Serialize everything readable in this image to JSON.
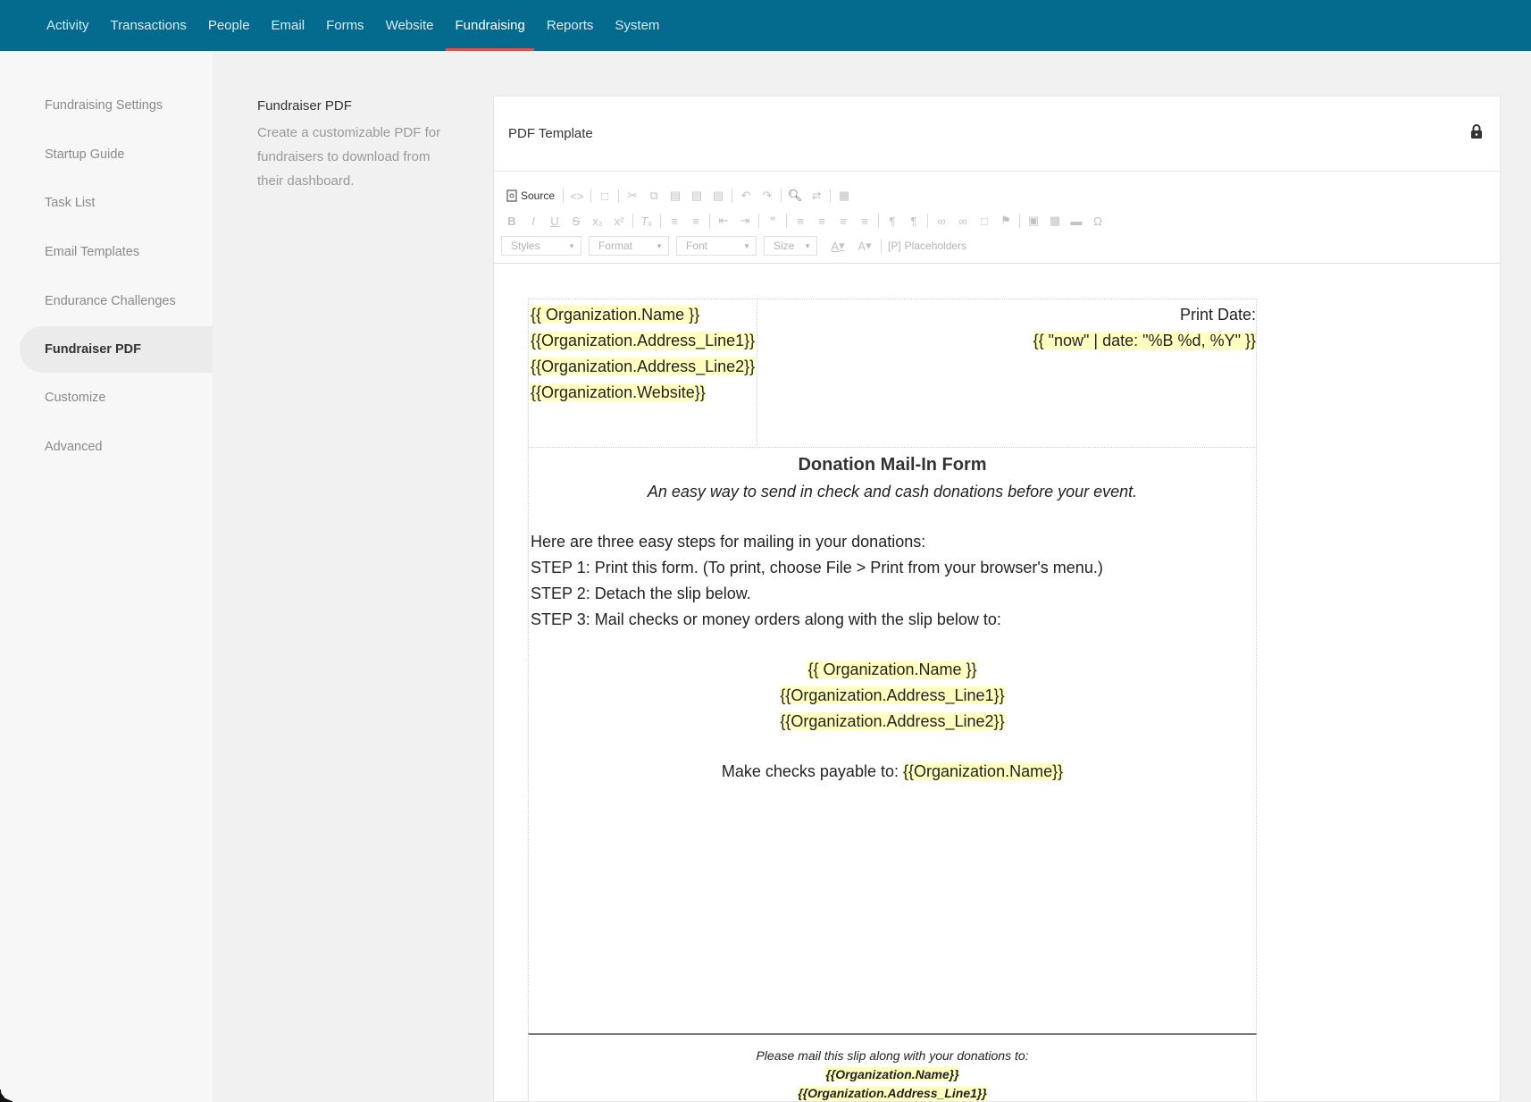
{
  "topnav": {
    "items": [
      {
        "label": "Activity",
        "active": false
      },
      {
        "label": "Transactions",
        "active": false
      },
      {
        "label": "People",
        "active": false
      },
      {
        "label": "Email",
        "active": false
      },
      {
        "label": "Forms",
        "active": false
      },
      {
        "label": "Website",
        "active": false
      },
      {
        "label": "Fundraising",
        "active": true
      },
      {
        "label": "Reports",
        "active": false
      },
      {
        "label": "System",
        "active": false
      }
    ],
    "active_underline_color": "#d9544f",
    "bg_color": "#046b8e"
  },
  "sidebar": {
    "items": [
      {
        "label": "Fundraising Settings",
        "active": false
      },
      {
        "label": "Startup Guide",
        "active": false
      },
      {
        "label": "Task List",
        "active": false
      },
      {
        "label": "Email Templates",
        "active": false
      },
      {
        "label": "Endurance Challenges",
        "active": false
      },
      {
        "label": "Fundraiser PDF",
        "active": true
      },
      {
        "label": "Customize",
        "active": false
      },
      {
        "label": "Advanced",
        "active": false
      }
    ]
  },
  "description": {
    "title": "Fundraiser PDF",
    "text": "Create a customizable PDF for fundraisers to download from their dashboard."
  },
  "panel": {
    "title": "PDF Template",
    "lock_icon": "lock-icon"
  },
  "toolbar": {
    "source_label": "Source",
    "styles_label": "Styles",
    "format_label": "Format",
    "font_label": "Font",
    "size_label": "Size",
    "text_color_label": "A",
    "bg_color_label": "A",
    "placeholders_label": "Placeholders",
    "placeholders_icon_text": "[P]"
  },
  "document": {
    "header_left": [
      "{{ Organization.Name }}",
      "{{Organization.Address_Line1}}",
      "{{Organization.Address_Line2}}",
      "{{Organization.Website}}"
    ],
    "print_date_label": "Print Date:",
    "print_date_value": "{{ \"now\" | date: \"%B %d, %Y\" }}",
    "form_title": "Donation Mail-In Form",
    "form_subtitle": "An easy way to send in check and cash donations before your event.",
    "intro": "Here are three easy steps for mailing in your donations:",
    "steps": [
      "STEP 1: Print this form. (To print, choose File > Print from your browser's menu.)",
      "STEP 2: Detach the slip below.",
      "STEP 3: Mail checks or money orders along with the slip below to:"
    ],
    "mail_to": [
      "{{ Organization.Name }}",
      "{{Organization.Address_Line1}}",
      "{{Organization.Address_Line2}}"
    ],
    "payable_label": "Make checks payable to:",
    "payable_value": "{{Organization.Name}}",
    "slip_instruction": "Please mail this slip along with your donations to:",
    "slip_lines": [
      "{{Organization.Name}}",
      "{{Organization.Address_Line1}}"
    ],
    "highlight_color": "#ffffbf"
  }
}
